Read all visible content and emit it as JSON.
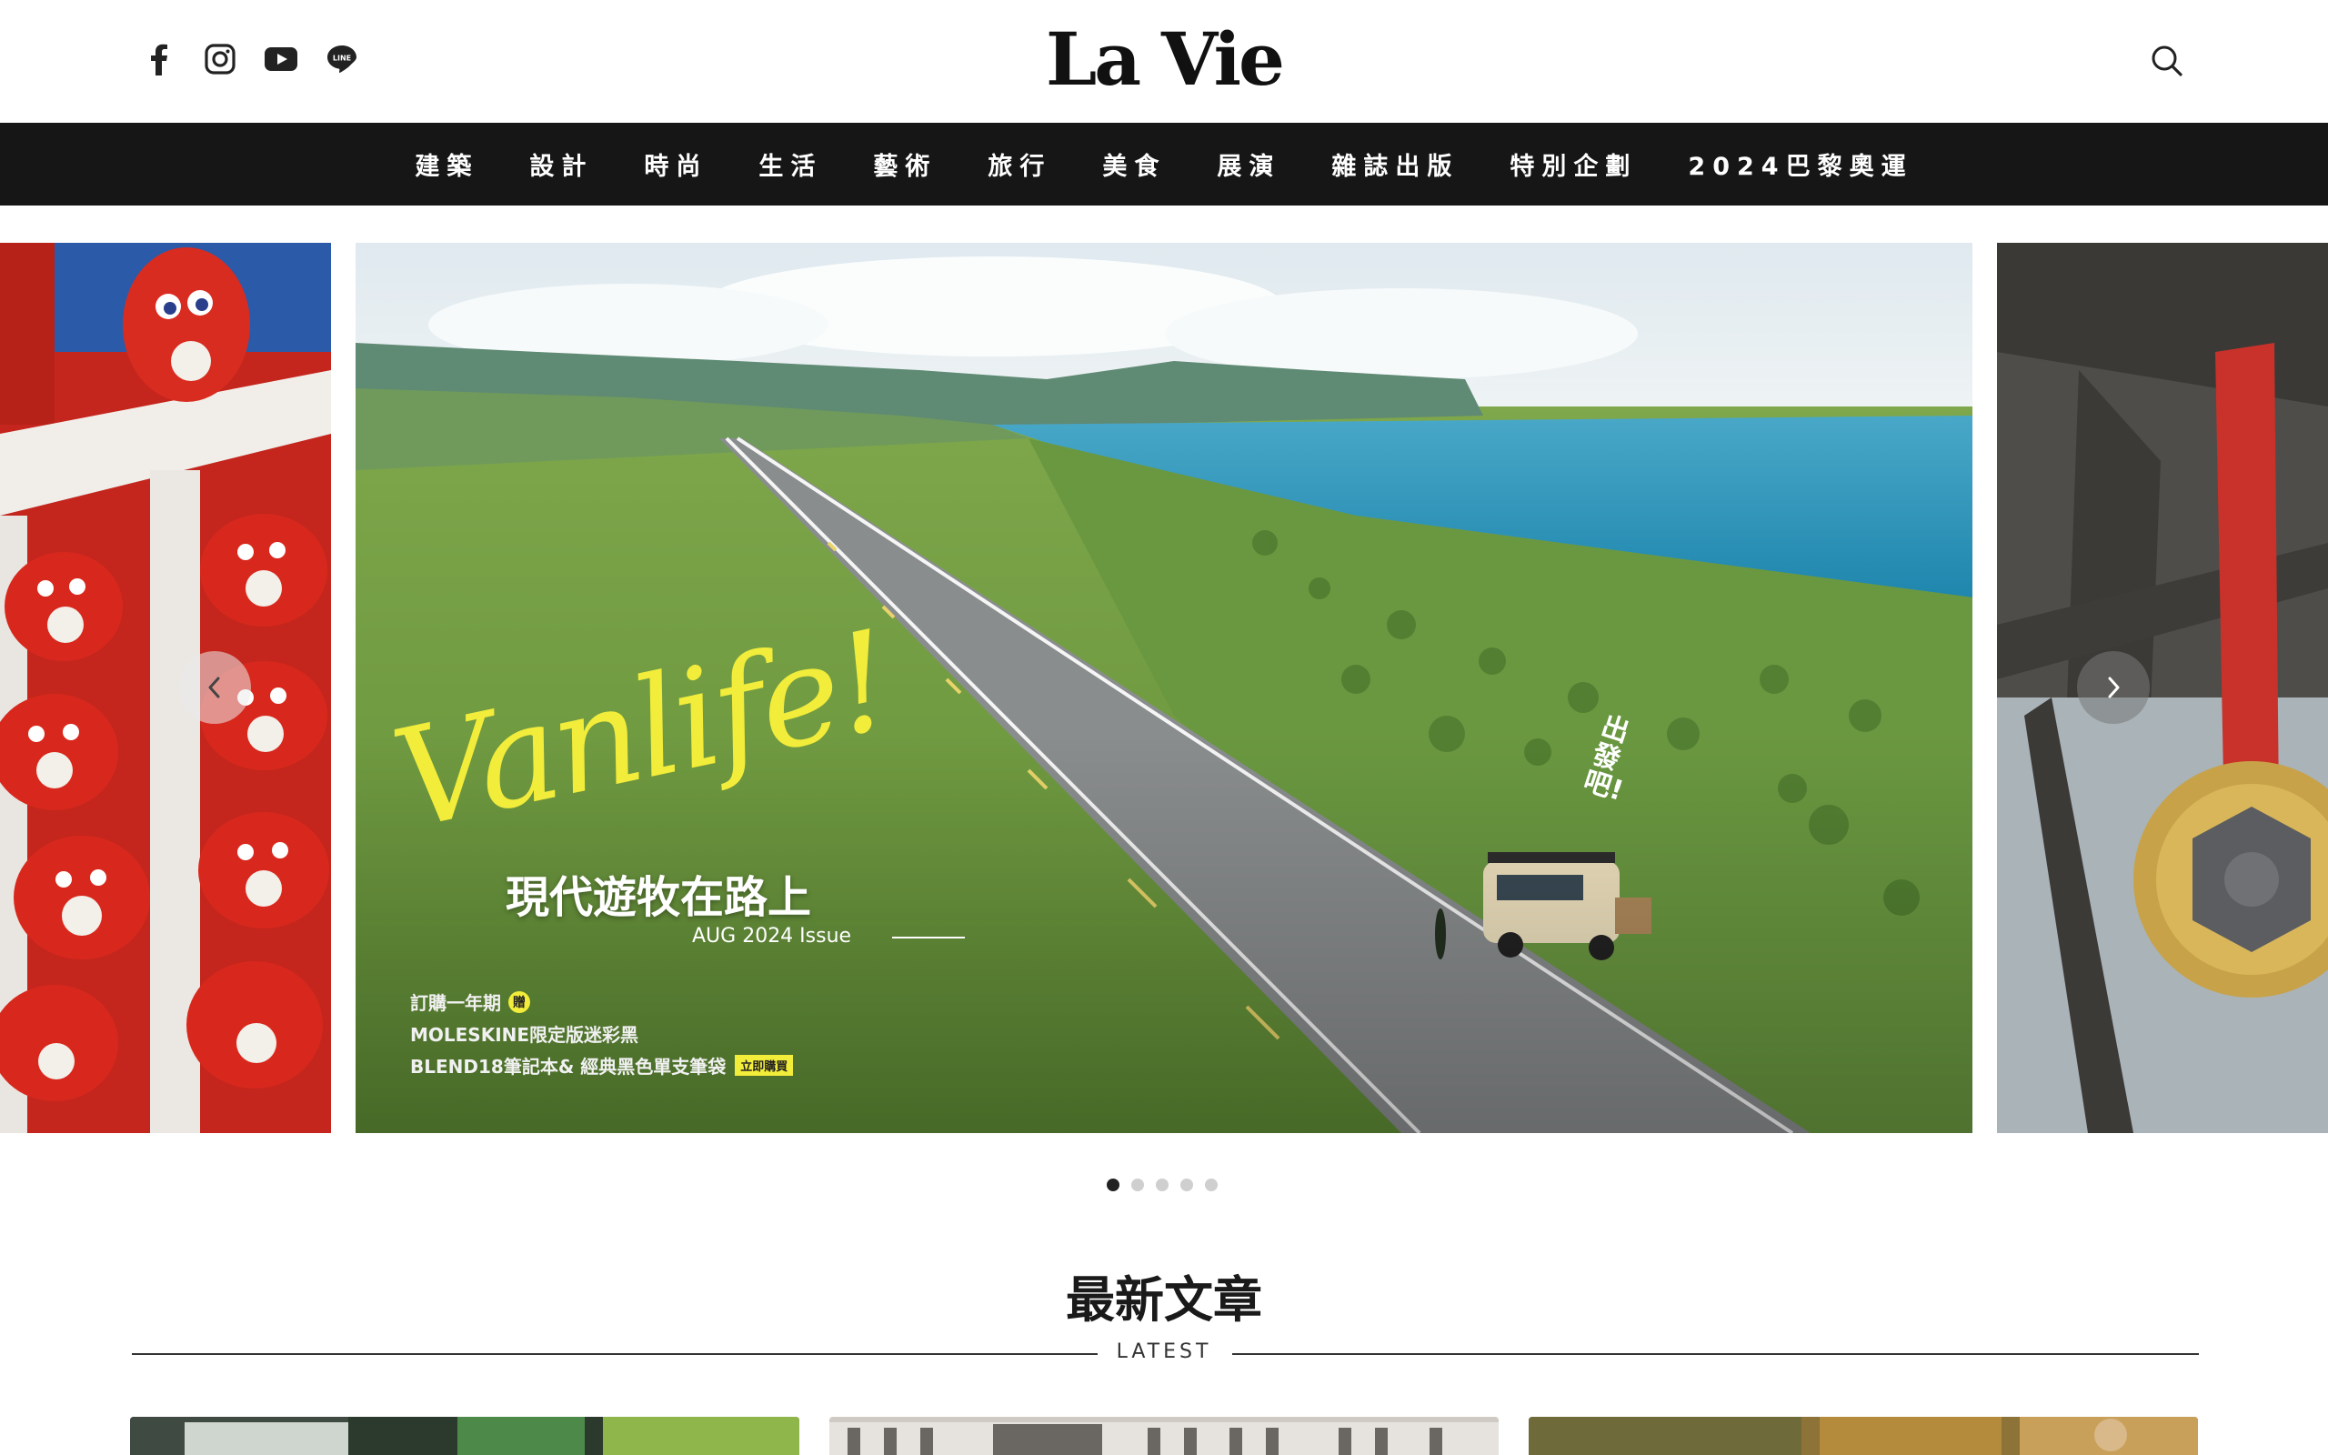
{
  "header": {
    "logo": "La Vie",
    "social_icons": [
      "facebook-icon",
      "instagram-icon",
      "youtube-icon",
      "line-icon"
    ],
    "line_icon_text": "LINE",
    "search_icon": "search-icon"
  },
  "nav": {
    "items": [
      "建築",
      "設計",
      "時尚",
      "生活",
      "藝術",
      "旅行",
      "美食",
      "展演",
      "雜誌出版",
      "特別企劃",
      "2024巴黎奧運"
    ]
  },
  "carousel": {
    "main_slide": {
      "script_title": "Vanlife!",
      "headline": "現代遊牧在路上",
      "issue": "AUG 2024 Issue",
      "callout": "出發吧!",
      "promo_line1": "訂購一年期",
      "promo_badge": "贈",
      "promo_line2": "MOLESKINE限定版迷彩黑",
      "promo_line3": "BLEND18筆記本& 經典黑色單支筆袋",
      "promo_cta": "立即購買"
    },
    "dots_total": 5,
    "active_dot": 1
  },
  "latest": {
    "title": "最新文章",
    "subtitle": "LATEST"
  },
  "colors": {
    "nav_bg": "#161616",
    "accent_yellow": "#f2ec3a",
    "sea": "#2a93b8",
    "grass": "#6f9a3f"
  }
}
